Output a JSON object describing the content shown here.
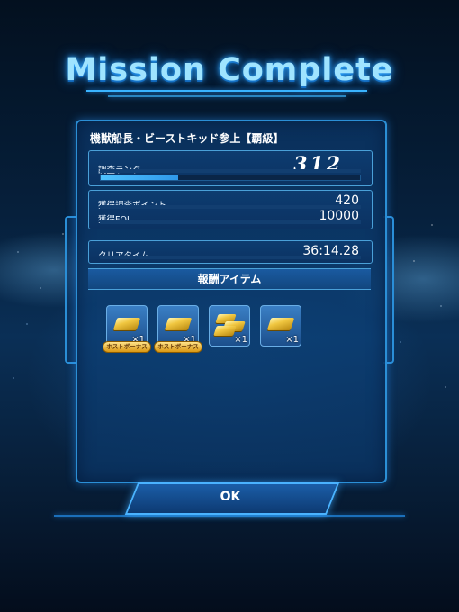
{
  "title": "Mission Complete",
  "mission": {
    "name": "機獣船長・ビーストキッド参上【覇級】"
  },
  "rank": {
    "label": "調査ランク",
    "value": "312",
    "progress": 0.3
  },
  "points": [
    {
      "label": "獲得調査ポイント",
      "value": "420"
    },
    {
      "label": "獲得FOL",
      "value": "10000"
    }
  ],
  "clear_time": {
    "label": "クリアタイム",
    "value": "36:14.28"
  },
  "rewards": {
    "header": "報酬アイテム",
    "items": [
      {
        "icon": "gold-bar-icon",
        "qty": "×1",
        "badge": "ホストボーナス"
      },
      {
        "icon": "gold-bar-icon",
        "qty": "×1",
        "badge": "ホストボーナス"
      },
      {
        "icon": "gold-bar-stack-icon",
        "qty": "×1",
        "badge": ""
      },
      {
        "icon": "gold-bar-icon",
        "qty": "×1",
        "badge": ""
      }
    ]
  },
  "ok_button": "OK",
  "colors": {
    "accent": "#3ab4ff",
    "panel": "#0c3e73",
    "gold": "#f0c640"
  }
}
